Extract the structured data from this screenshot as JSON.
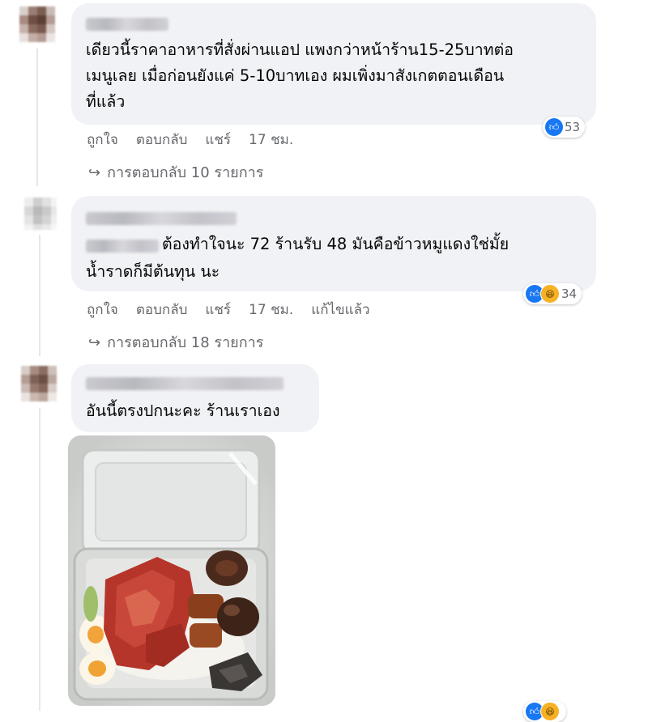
{
  "comments": [
    {
      "text_lines": [
        "เดียวนี้ราคาอาหารที่สั่งผ่านแอป แพงกว่าหน้าร้าน15-25บาทต่อ",
        "เมนูเลย เมื่อก่อนยังแค่ 5-10บาทเอง ผมเพิ่งมาสังเกตตอนเดือน",
        "ที่แล้ว"
      ],
      "actions": {
        "like": "ถูกใจ",
        "reply": "ตอบกลับ",
        "share": "แชร์",
        "time": "17 ชม."
      },
      "reaction_count": "53",
      "replies_label": "การตอบกลับ 10 รายการ"
    },
    {
      "text_lines": [
        "ต้องทำใจนะ 72 ร้านรับ 48 มันคือข้าวหมูแดงใช่มั้ย",
        "น้ำราดก็มีต้นทุน นะ"
      ],
      "actions": {
        "like": "ถูกใจ",
        "reply": "ตอบกลับ",
        "share": "แชร์",
        "time": "17 ชม.",
        "edited": "แก้ไขแล้ว"
      },
      "reaction_count": "34",
      "replies_label": "การตอบกลับ 18 รายการ"
    },
    {
      "text_lines": [
        "อันนี้ตรงปกนะคะ ร้านเราเอง"
      ]
    }
  ],
  "icons": {
    "like": "like-icon",
    "haha": "haha-icon",
    "reply_arrow": "reply-arrow-icon"
  },
  "colors": {
    "bubble": "#f0f2f5",
    "like_blue": "#1877f2",
    "meta_gray": "#65676b"
  }
}
